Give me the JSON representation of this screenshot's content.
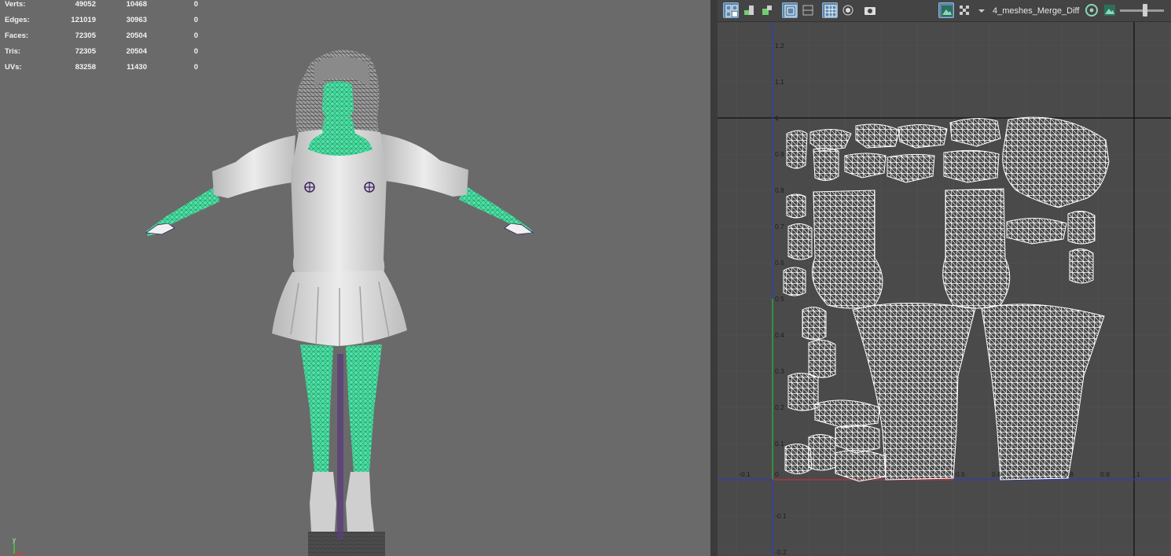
{
  "hud": {
    "rows": [
      {
        "label": "Verts:",
        "values": [
          "49052",
          "10468",
          "0"
        ]
      },
      {
        "label": "Edges:",
        "values": [
          "121019",
          "30963",
          "0"
        ]
      },
      {
        "label": "Faces:",
        "values": [
          "72305",
          "20504",
          "0"
        ]
      },
      {
        "label": "Tris:",
        "values": [
          "72305",
          "20504",
          "0"
        ]
      },
      {
        "label": "UVs:",
        "values": [
          "83258",
          "11430",
          "0"
        ]
      }
    ]
  },
  "uv_editor": {
    "texture_name": "4_meshes_Merge_Diff",
    "toolbar_icons": [
      "uv-shell-display-icon",
      "filter-icon",
      "grid-snap-icon",
      "wireframe-toggle-icon",
      "frame-icon",
      "grid-toggle-icon",
      "isolate-icon",
      "snapshot-icon",
      "image-display-icon",
      "checker-icon",
      "dropdown-arrow-icon",
      "uv-sync-icon",
      "texture-icon"
    ],
    "u_ticks": [
      "-0.1",
      "0",
      "0.5",
      "0.6",
      "0.8",
      "0.9",
      "1"
    ],
    "v_ticks": [
      "1.2",
      "1.1",
      "1",
      "0.9",
      "0.8",
      "0.7",
      "0.6",
      "0.5",
      "0.4",
      "0.3",
      "0.2",
      "0.1",
      "-0.1",
      "-0.2"
    ]
  },
  "viewport": {
    "axis_label": "y"
  },
  "colors": {
    "viewport_bg": "#6a6a6a",
    "uv_bg": "#4a4a4a",
    "selection_green": "#4be8a8",
    "uv_wire": "#ffffff",
    "active_button": "#5b86ad"
  }
}
